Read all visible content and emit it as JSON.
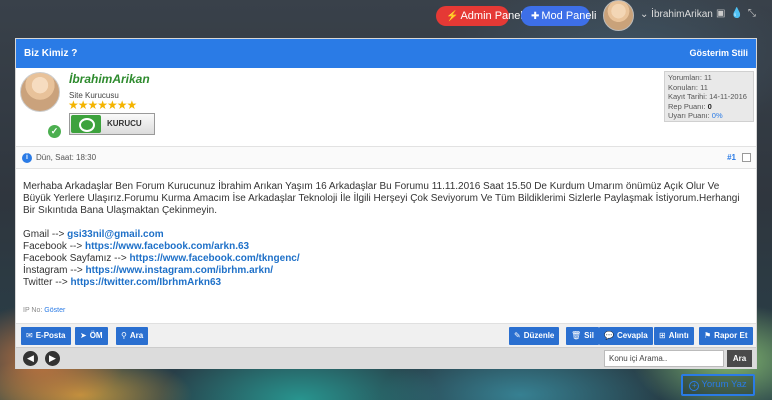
{
  "topbar": {
    "admin_label": "Admin Paneli",
    "mod_label": "Mod Paneli",
    "username": "İbrahimArikan"
  },
  "thread": {
    "title": "Biz Kimiz ?",
    "show_style": "Gösterim Stili"
  },
  "author": {
    "name": "İbrahimArikan",
    "role": "Site Kurucusu",
    "stars": "★★★★★★★",
    "rank_label": "KURUCU",
    "stats": {
      "posts": "Yorumları: 11",
      "topics": "Konuları: 11",
      "joined": "Kayıt Tarihi: 14-11-2016",
      "rep_label": "Rep Puanı:",
      "rep_value": "0",
      "warn_label": "Uyarı Puanı:",
      "warn_value": "0%"
    }
  },
  "post": {
    "time": "Dün, Saat: 18:30",
    "number": "#1",
    "paragraph": "Merhaba Arkadaşlar Ben Forum Kurucunuz İbrahim Arıkan Yaşım 16 Arkadaşlar Bu Forumu 11.11.2016 Saat 15.50 De Kurdum Umarım önümüz Açık Olur Ve Büyük Yerlere Ulaşırız.Forumu Kurma Amacım İse Arkadaşlar Teknoloji İle İlgili Herşeyi Çok Seviyorum Ve Tüm Bildiklerimi Sizlerle Paylaşmak İstiyorum.Herhangi Bir Sıkıntıda Bana Ulaşmaktan Çekinmeyin.",
    "links": [
      {
        "label": "Gmail --> ",
        "value": "gsi33nil@gmail.com"
      },
      {
        "label": "Facebook --> ",
        "value": "https://www.facebook.com/arkn.63"
      },
      {
        "label": "Facebook Sayfamız --> ",
        "value": "https://www.facebook.com/tkngenc/"
      },
      {
        "label": "İnstagram --> ",
        "value": "https://www.instagram.com/ibrhm.arkn/"
      },
      {
        "label": "Twitter --> ",
        "value": "https://twitter.com/IbrhmArkn63"
      }
    ],
    "ip_label": "IP No:",
    "ip_show": "Göster"
  },
  "actions": {
    "email": "E-Posta",
    "pm": "ÖM",
    "search": "Ara",
    "edit": "Düzenle",
    "delete": "Sil",
    "reply": "Cevapla",
    "quote": "Alıntı",
    "report": "Rapor Et"
  },
  "bottom": {
    "search_placeholder": "Konu içi Arama..",
    "search_button": "Ara"
  },
  "reply_button": "Yorum Yaz",
  "colors": {
    "accent": "#2a7be6",
    "admin": "#e53935",
    "mod": "#3d6fe8",
    "username": "#2e8b2e"
  }
}
